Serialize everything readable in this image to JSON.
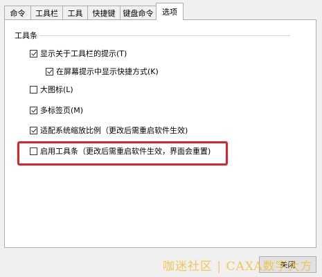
{
  "tabs": [
    {
      "label": "命令"
    },
    {
      "label": "工具栏"
    },
    {
      "label": "工具"
    },
    {
      "label": "快捷键"
    },
    {
      "label": "键盘命令"
    },
    {
      "label": "选项"
    }
  ],
  "active_tab": "选项",
  "group": {
    "title": "工具条",
    "options": [
      {
        "label": "显示关于工具栏的提示(T)",
        "checked": true
      },
      {
        "label": "在屏幕提示中显示快捷方式(K)",
        "checked": true
      },
      {
        "label": "大图标(L)",
        "checked": false
      },
      {
        "label": "多标签页(M)",
        "checked": true
      },
      {
        "label": "适配系统缩放比例（更改后需重启软件生效)",
        "checked": true
      },
      {
        "label": "启用工具条（更改后需重启软件生效，界面会重置)",
        "checked": false
      }
    ]
  },
  "buttons": {
    "close": "关闭"
  },
  "watermark": "咖迷社区 | CAXA数字大方",
  "colors": {
    "highlight": "#e0202a"
  }
}
